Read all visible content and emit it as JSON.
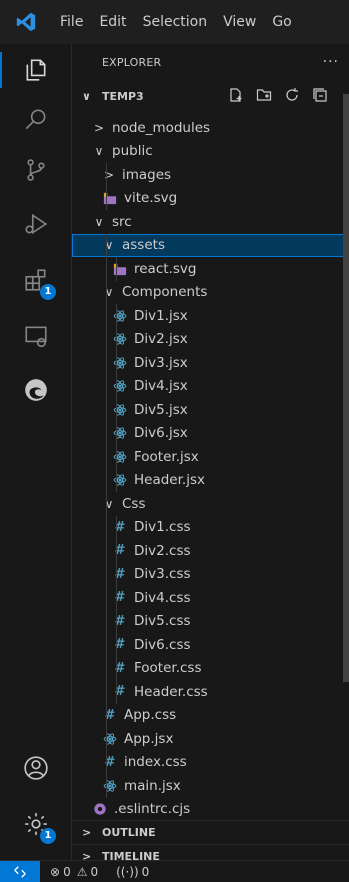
{
  "titlebar": {
    "menu": [
      "File",
      "Edit",
      "Selection",
      "View",
      "Go"
    ]
  },
  "activitybar": {
    "items": [
      {
        "icon": "explorer-icon",
        "active": true
      },
      {
        "icon": "search-icon"
      },
      {
        "icon": "source-control-icon"
      },
      {
        "icon": "run-debug-icon"
      },
      {
        "icon": "extensions-icon",
        "badge": "1"
      },
      {
        "icon": "remote-explorer-icon"
      },
      {
        "icon": "edge-icon"
      }
    ],
    "bottom": [
      {
        "icon": "accounts-icon"
      },
      {
        "icon": "manage-gear-icon",
        "badge": "1"
      }
    ]
  },
  "sidebar": {
    "title": "EXPLORER",
    "more": "···",
    "root_label": "TEMP3",
    "root_chevron": "∨",
    "tree": [
      {
        "label": "node_modules",
        "kind": "folder",
        "open": false,
        "depth": 1
      },
      {
        "label": "public",
        "kind": "folder",
        "open": true,
        "depth": 1
      },
      {
        "label": "images",
        "kind": "folder",
        "open": false,
        "depth": 2
      },
      {
        "label": "vite.svg",
        "kind": "svg",
        "depth": 2
      },
      {
        "label": "src",
        "kind": "folder",
        "open": true,
        "depth": 1
      },
      {
        "label": "assets",
        "kind": "folder",
        "open": true,
        "depth": 2,
        "selected": true
      },
      {
        "label": "react.svg",
        "kind": "svg",
        "depth": 3
      },
      {
        "label": "Components",
        "kind": "folder",
        "open": true,
        "depth": 2
      },
      {
        "label": "Div1.jsx",
        "kind": "jsx",
        "depth": 3
      },
      {
        "label": "Div2.jsx",
        "kind": "jsx",
        "depth": 3
      },
      {
        "label": "Div3.jsx",
        "kind": "jsx",
        "depth": 3
      },
      {
        "label": "Div4.jsx",
        "kind": "jsx",
        "depth": 3
      },
      {
        "label": "Div5.jsx",
        "kind": "jsx",
        "depth": 3
      },
      {
        "label": "Div6.jsx",
        "kind": "jsx",
        "depth": 3
      },
      {
        "label": "Footer.jsx",
        "kind": "jsx",
        "depth": 3
      },
      {
        "label": "Header.jsx",
        "kind": "jsx",
        "depth": 3
      },
      {
        "label": "Css",
        "kind": "folder",
        "open": true,
        "depth": 2
      },
      {
        "label": "Div1.css",
        "kind": "css",
        "depth": 3
      },
      {
        "label": "Div2.css",
        "kind": "css",
        "depth": 3
      },
      {
        "label": "Div3.css",
        "kind": "css",
        "depth": 3
      },
      {
        "label": "Div4.css",
        "kind": "css",
        "depth": 3
      },
      {
        "label": "Div5.css",
        "kind": "css",
        "depth": 3
      },
      {
        "label": "Div6.css",
        "kind": "css",
        "depth": 3
      },
      {
        "label": "Footer.css",
        "kind": "css",
        "depth": 3
      },
      {
        "label": "Header.css",
        "kind": "css",
        "depth": 3
      },
      {
        "label": "App.css",
        "kind": "css",
        "depth": 2
      },
      {
        "label": "App.jsx",
        "kind": "jsx",
        "depth": 2
      },
      {
        "label": "index.css",
        "kind": "css",
        "depth": 2
      },
      {
        "label": "main.jsx",
        "kind": "jsx",
        "depth": 2
      },
      {
        "label": ".eslintrc.cjs",
        "kind": "eslint",
        "depth": 1
      }
    ],
    "outline_label": "OUTLINE",
    "timeline_label": "TIMELINE"
  },
  "statusbar": {
    "errors": "0",
    "warnings": "0",
    "ports": "0"
  },
  "colors": {
    "accent": "#0078d4",
    "selected_bg": "#04395e",
    "css_icon": "#519aba",
    "react_icon": "#4ea7c8",
    "svg_icon": "#a074c4",
    "eslint_icon": "#a074c4"
  }
}
